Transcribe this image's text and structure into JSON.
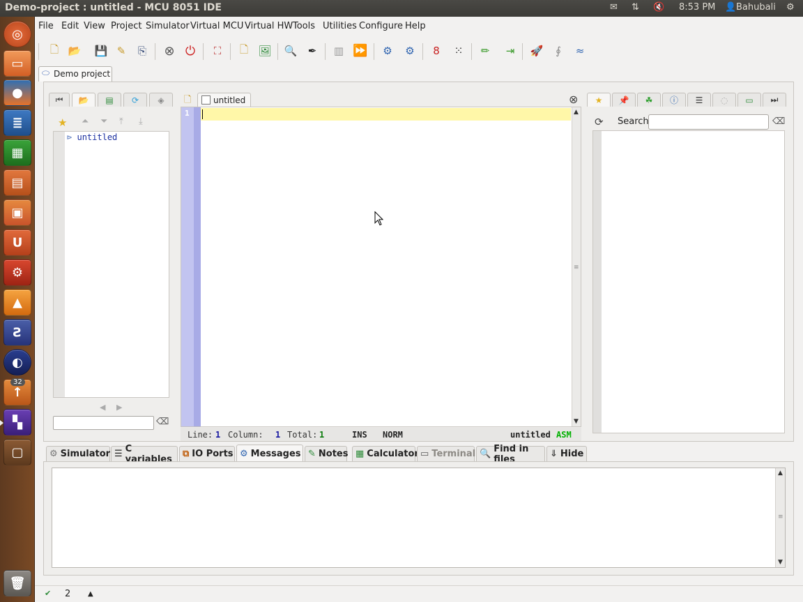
{
  "window": {
    "title": "Demo-project : untitled - MCU 8051 IDE"
  },
  "tray": {
    "time": "8:53 PM",
    "user": "Bahubali"
  },
  "launcher": {
    "badge_count": "32"
  },
  "menu": [
    "File",
    "Edit",
    "View",
    "Project",
    "Simulator",
    "Virtual MCU",
    "Virtual HW",
    "Tools",
    "Utilities",
    "Configure",
    "Help"
  ],
  "project_tab": {
    "label": "Demo project"
  },
  "editor_tab": {
    "label": "untitled"
  },
  "left_panel": {
    "file_item": "untitled"
  },
  "editor": {
    "line_number": "1"
  },
  "status": {
    "line_label": "Line:",
    "line_value": "1",
    "column_label": "Column:",
    "column_value": "1",
    "total_label": "Total:",
    "total_value": "1",
    "mode": "INS",
    "sel_mode": "NORM",
    "filename": "untitled",
    "filetype": "ASM"
  },
  "right_panel": {
    "search_label": "Search:",
    "search_value": ""
  },
  "bottom_tabs": [
    "Simulator",
    "C variables",
    "IO Ports",
    "Messages",
    "Notes",
    "Calculator",
    "Terminal",
    "Find in files",
    "Hide"
  ],
  "bottom_status": {
    "spell_count": "2"
  },
  "colors": {
    "topbar": "#3c3b37",
    "launcher": "#6e4322",
    "current_line": "#fff7a8",
    "line_gutter": "#c2c4f0",
    "asm_label": "#00b000",
    "status_num": "#1515a0"
  }
}
